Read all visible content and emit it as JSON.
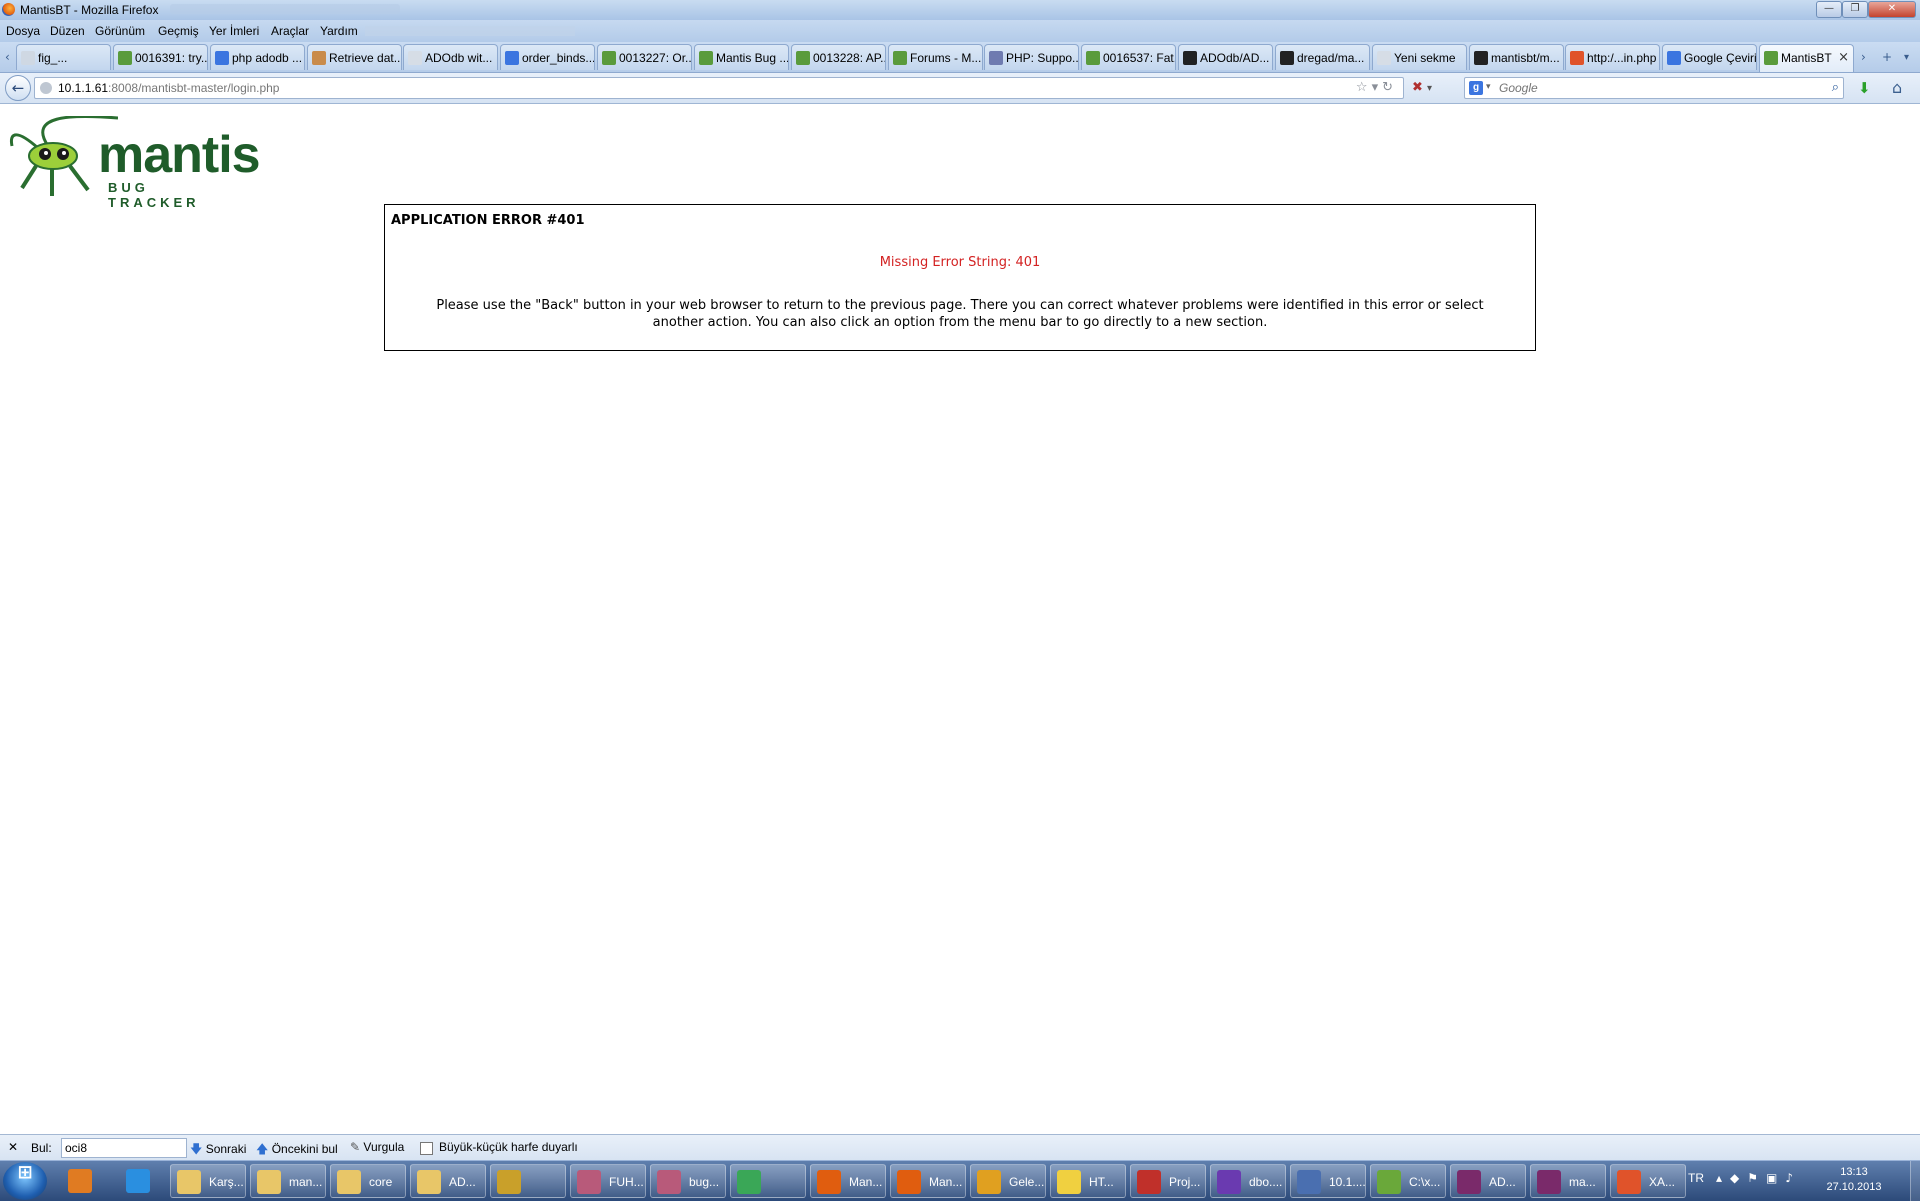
{
  "window": {
    "title": "MantisBT - Mozilla Firefox",
    "controls": [
      "—",
      "❐",
      "✕"
    ]
  },
  "menu": [
    "Dosya",
    "Düzen",
    "Görünüm",
    "Geçmiş",
    "Yer İmleri",
    "Araçlar",
    "Yardım"
  ],
  "tabs": [
    {
      "label": "fig_..."
    },
    {
      "label": "0016391: try..."
    },
    {
      "label": "php adodb ..."
    },
    {
      "label": "Retrieve dat..."
    },
    {
      "label": "ADOdb wit..."
    },
    {
      "label": "order_binds..."
    },
    {
      "label": "0013227: Or..."
    },
    {
      "label": "Mantis Bug ..."
    },
    {
      "label": "0013228: AP..."
    },
    {
      "label": "Forums - M..."
    },
    {
      "label": "PHP: Suppo..."
    },
    {
      "label": "0016537: Fat..."
    },
    {
      "label": "ADOdb/AD..."
    },
    {
      "label": "dregad/ma..."
    },
    {
      "label": "Yeni sekme"
    },
    {
      "label": "mantisbt/m..."
    },
    {
      "label": "http:/...in.php"
    },
    {
      "label": "Google Çeviri"
    },
    {
      "label": "MantisBT"
    }
  ],
  "tab_colors": [
    "#cfd8e3",
    "#5a9b3c",
    "#3b75e0",
    "#c98b4a",
    "#d6dde6",
    "#3b75e0",
    "#5a9b3c",
    "#5a9b3c",
    "#5a9b3c",
    "#5a9b3c",
    "#6f7bb0",
    "#5a9b3c",
    "#222222",
    "#222222",
    "#d6dde6",
    "#222222",
    "#e0532a",
    "#3b75e0",
    "#5a9b3c"
  ],
  "nav": {
    "url_host": "10.1.1.61",
    "url_path": ":8008/mantisbt-master/login.php",
    "search_placeholder": "Google",
    "search_engine_letter": "g"
  },
  "logo": {
    "word": "mantis",
    "sub": "BUG TRACKER"
  },
  "error": {
    "heading": "APPLICATION ERROR #401",
    "message": "Missing Error String: 401",
    "body": "Please use the \"Back\" button in your web browser to return to the previous page. There you can correct whatever problems were identified in this error or select another action. You can also click an option from the menu bar to go directly to a new section.",
    "message_color": "#d32222"
  },
  "findbar": {
    "label": "Bul:",
    "value": "oci8",
    "next": "Sonraki",
    "previous": "Öncekini bul",
    "highlight": "Vurgula",
    "match_case": "Büyük-küçük harfe duyarlı"
  },
  "taskbar": {
    "pinned": [
      {
        "icon": "media-player-icon",
        "color": "#e07b22"
      },
      {
        "icon": "ie-icon",
        "color": "#2a8fe0"
      }
    ],
    "items": [
      {
        "label": "Karş...",
        "color": "#e8c668"
      },
      {
        "label": "man...",
        "color": "#e8c668"
      },
      {
        "label": "core",
        "color": "#e8c668"
      },
      {
        "label": "AD...",
        "color": "#e8c668"
      },
      {
        "label": "",
        "color": "#c9a02a"
      },
      {
        "label": "FUH...",
        "color": "#b85a7a"
      },
      {
        "label": "bug...",
        "color": "#b85a7a"
      },
      {
        "label": "",
        "color": "#3aa757"
      },
      {
        "label": "Man...",
        "color": "#e05d0f"
      },
      {
        "label": "Man...",
        "color": "#e05d0f"
      },
      {
        "label": "Gele...",
        "color": "#e0a020"
      },
      {
        "label": "HT...",
        "color": "#f0d040"
      },
      {
        "label": "Proj...",
        "color": "#c0302a"
      },
      {
        "label": "dbo....",
        "color": "#6a3ab0"
      },
      {
        "label": "10.1....",
        "color": "#4a6fb0"
      },
      {
        "label": "C:\\x...",
        "color": "#6aa83a"
      },
      {
        "label": "AD...",
        "color": "#7a2a6a"
      },
      {
        "label": "ma...",
        "color": "#7a2a6a"
      },
      {
        "label": "XA...",
        "color": "#e0532a"
      }
    ],
    "tray": {
      "lang": "TR",
      "time": "13:13",
      "date": "27.10.2013"
    }
  }
}
